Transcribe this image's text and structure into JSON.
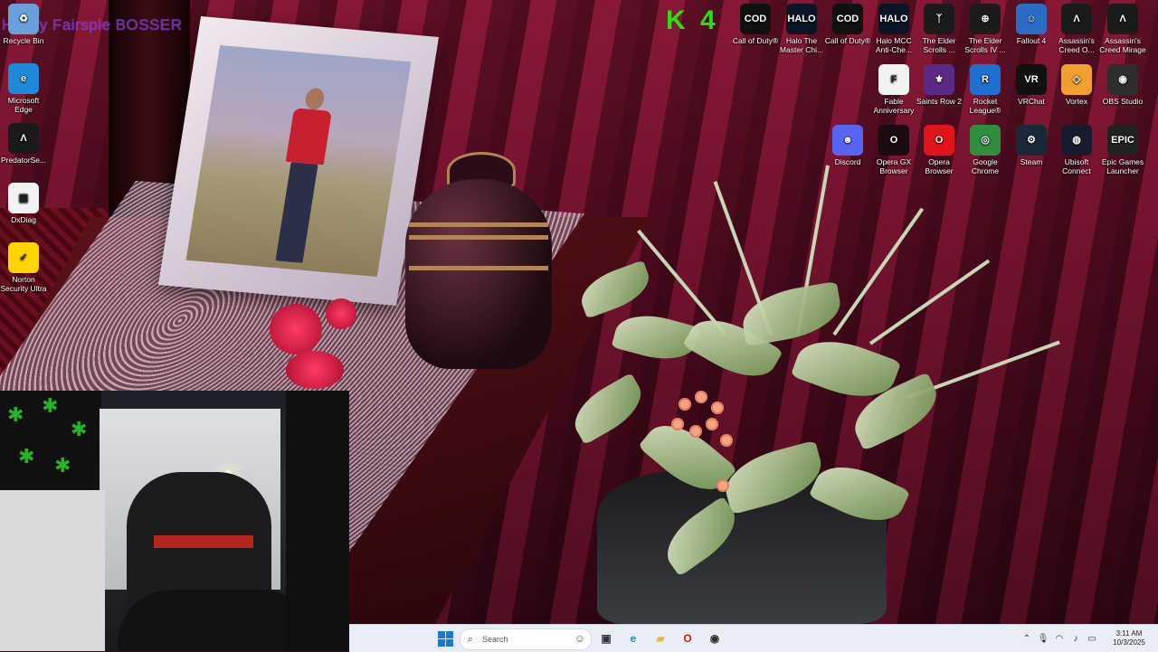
{
  "overlay": {
    "stream_label": "Hillary Fairspie BOSSER",
    "k_badge": "K 4"
  },
  "desktop_left": [
    {
      "label": "Recycle Bin",
      "icon": "recycle-bin-icon",
      "color": "#6aa0d8",
      "glyph": "♻"
    },
    {
      "label": "Microsoft Edge",
      "icon": "edge-icon",
      "color": "#1f8ad8",
      "glyph": "e"
    },
    {
      "label": "PredatorSe...",
      "icon": "predator-sense-icon",
      "color": "#1a1a1a",
      "glyph": "Λ"
    },
    {
      "label": "DxDiag",
      "icon": "file-icon",
      "color": "#f2f2f2",
      "glyph": "▤"
    },
    {
      "label": "Norton Security Ultra",
      "icon": "norton-icon",
      "color": "#ffd400",
      "glyph": "✓"
    }
  ],
  "desktop_row1": [
    {
      "label": "Call of Duty®",
      "icon": "call-of-duty-icon",
      "color": "#111111",
      "glyph": "COD"
    },
    {
      "label": "Halo The Master Chi...",
      "icon": "halo-mcc-icon",
      "color": "#0b1526",
      "glyph": "HALO"
    },
    {
      "label": "Call of Duty®",
      "icon": "call-of-duty-icon",
      "color": "#111111",
      "glyph": "COD"
    },
    {
      "label": "Halo MCC Anti-Che...",
      "icon": "halo-mcc-anticheat-icon",
      "color": "#0b1526",
      "glyph": "HALO"
    },
    {
      "label": "The Elder Scrolls ...",
      "icon": "elder-scrolls-icon",
      "color": "#1b1b1b",
      "glyph": "ᛉ"
    },
    {
      "label": "The Elder Scrolls IV ...",
      "icon": "oblivion-icon",
      "color": "#1b1b1b",
      "glyph": "⊕"
    },
    {
      "label": "Fallout 4",
      "icon": "fallout-4-icon",
      "color": "#2b6cc4",
      "glyph": "☺"
    },
    {
      "label": "Assassin's Creed O...",
      "icon": "assassins-creed-origins-icon",
      "color": "#1b1b1b",
      "glyph": "Λ"
    },
    {
      "label": "Assassin's Creed Mirage",
      "icon": "assassins-creed-mirage-icon",
      "color": "#1b1b1b",
      "glyph": "Λ"
    }
  ],
  "desktop_row2": [
    {
      "label": "Fable Anniversary",
      "icon": "fable-icon",
      "color": "#f2f2f2",
      "glyph": "F"
    },
    {
      "label": "Saints Row 2",
      "icon": "saints-row-icon",
      "color": "#5b2a86",
      "glyph": "⚜"
    },
    {
      "label": "Rocket League®",
      "icon": "rocket-league-icon",
      "color": "#1f6fd1",
      "glyph": "R"
    },
    {
      "label": "VRChat",
      "icon": "vrchat-icon",
      "color": "#111111",
      "glyph": "VR"
    },
    {
      "label": "Vortex",
      "icon": "vortex-icon",
      "color": "#f0a030",
      "glyph": "◇"
    },
    {
      "label": "OBS Studio",
      "icon": "obs-studio-icon",
      "color": "#2e2e2e",
      "glyph": "◉"
    }
  ],
  "desktop_row3": [
    {
      "label": "Discord",
      "icon": "discord-icon",
      "color": "#5865f2",
      "glyph": "☻"
    },
    {
      "label": "Opera GX Browser",
      "icon": "opera-gx-icon",
      "color": "#1b0b12",
      "glyph": "O"
    },
    {
      "label": "Opera Browser",
      "icon": "opera-icon",
      "color": "#e1131b",
      "glyph": "O"
    },
    {
      "label": "Google Chrome",
      "icon": "chrome-icon",
      "color": "#2f8f3e",
      "glyph": "◎"
    },
    {
      "label": "Steam",
      "icon": "steam-icon",
      "color": "#1b2838",
      "glyph": "⚙"
    },
    {
      "label": "Ubisoft Connect",
      "icon": "ubisoft-connect-icon",
      "color": "#1a1a2e",
      "glyph": "◍"
    },
    {
      "label": "Epic Games Launcher",
      "icon": "epic-games-icon",
      "color": "#222222",
      "glyph": "EPIC"
    }
  ],
  "taskbar": {
    "search_placeholder": "Search",
    "pinned": [
      {
        "name": "task-view-icon",
        "glyph": "▣",
        "color": "#333333"
      },
      {
        "name": "edge-icon",
        "glyph": "e",
        "color": "#1f8ad8"
      },
      {
        "name": "file-explorer-icon",
        "glyph": "▰",
        "color": "#e8b63a"
      },
      {
        "name": "opera-icon",
        "glyph": "O",
        "color": "#e1131b"
      },
      {
        "name": "obs-studio-icon",
        "glyph": "◉",
        "color": "#2e2e2e"
      }
    ],
    "clock_time": "3:11 AM",
    "clock_date": "10/3/2025"
  }
}
